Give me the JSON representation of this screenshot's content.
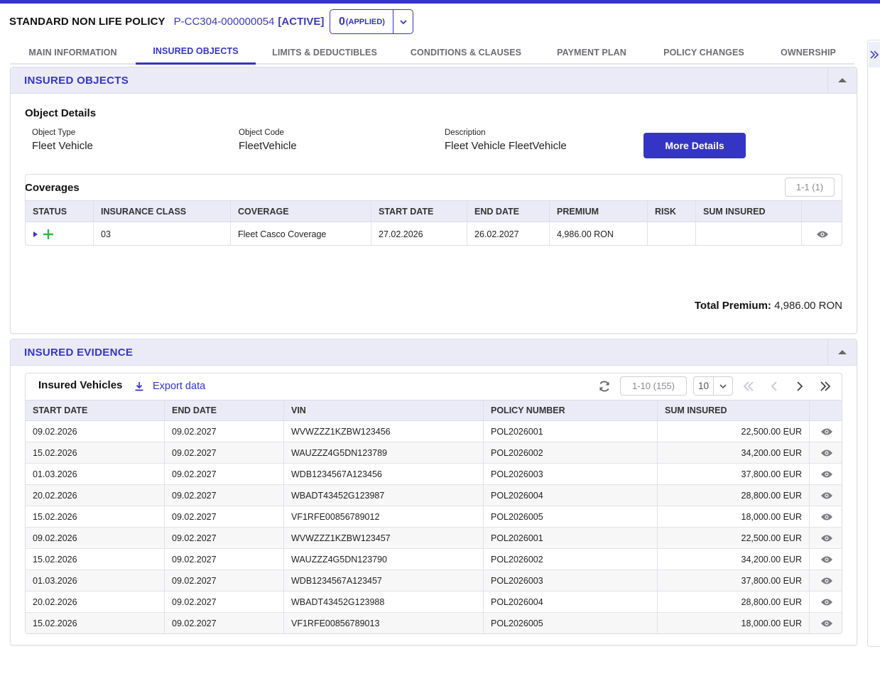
{
  "header": {
    "title": "STANDARD NON LIFE POLICY",
    "policy_id": "P-CC304-000000054",
    "status": "[ACTIVE]",
    "version_number": "0",
    "version_status": "(APPLIED)"
  },
  "tabs": [
    {
      "label": "MAIN INFORMATION"
    },
    {
      "label": "INSURED OBJECTS"
    },
    {
      "label": "LIMITS & DEDUCTIBLES"
    },
    {
      "label": "CONDITIONS & CLAUSES"
    },
    {
      "label": "PAYMENT PLAN"
    },
    {
      "label": "POLICY CHANGES"
    },
    {
      "label": "OWNERSHIP"
    }
  ],
  "active_tab": "INSURED OBJECTS",
  "colors": {
    "accent": "#3535c5",
    "header_bg": "#ebebf7",
    "add_green": "#2db84a"
  },
  "insured_objects": {
    "title": "INSURED OBJECTS",
    "object_details_title": "Object Details",
    "object_type_label": "Object Type",
    "object_type_value": "Fleet Vehicle",
    "object_code_label": "Object Code",
    "object_code_value": "FleetVehicle",
    "description_label": "Description",
    "description_value": "Fleet Vehicle FleetVehicle",
    "more_details_button": "More Details",
    "coverages_title": "Coverages",
    "coverages_pager": "1-1 (1)",
    "coverage_columns": [
      "STATUS",
      "INSURANCE CLASS",
      "COVERAGE",
      "START DATE",
      "END DATE",
      "PREMIUM",
      "RISK",
      "SUM INSURED"
    ],
    "coverage_rows": [
      {
        "insurance_class": "03",
        "coverage": "Fleet Casco Coverage",
        "start_date": "27.02.2026",
        "end_date": "26.02.2027",
        "premium": "4,986.00 RON",
        "risk": "",
        "sum_insured": ""
      }
    ],
    "total_premium_label": "Total Premium:",
    "total_premium_value": "4,986.00 RON"
  },
  "insured_evidence": {
    "title": "INSURED EVIDENCE",
    "table_title": "Insured Vehicles",
    "export_label": "Export data",
    "pager": "1-10 (155)",
    "page_size": "10",
    "columns": [
      "START DATE",
      "END DATE",
      "VIN",
      "POLICY NUMBER",
      "SUM INSURED"
    ],
    "rows": [
      {
        "start_date": "09.02.2026",
        "end_date": "09.02.2027",
        "vin": "WVWZZZ1KZBW123456",
        "policy_number": "POL2026001",
        "sum_insured": "22,500.00 EUR"
      },
      {
        "start_date": "15.02.2026",
        "end_date": "09.02.2027",
        "vin": "WAUZZZ4G5DN123789",
        "policy_number": "POL2026002",
        "sum_insured": "34,200.00 EUR"
      },
      {
        "start_date": "01.03.2026",
        "end_date": "09.02.2027",
        "vin": "WDB1234567A123456",
        "policy_number": "POL2026003",
        "sum_insured": "37,800.00 EUR"
      },
      {
        "start_date": "20.02.2026",
        "end_date": "09.02.2027",
        "vin": "WBADT43452G123987",
        "policy_number": "POL2026004",
        "sum_insured": "28,800.00 EUR"
      },
      {
        "start_date": "15.02.2026",
        "end_date": "09.02.2027",
        "vin": "VF1RFE00856789012",
        "policy_number": "POL2026005",
        "sum_insured": "18,000.00 EUR"
      },
      {
        "start_date": "09.02.2026",
        "end_date": "09.02.2027",
        "vin": "WVWZZZ1KZBW123457",
        "policy_number": "POL2026001",
        "sum_insured": "22,500.00 EUR"
      },
      {
        "start_date": "15.02.2026",
        "end_date": "09.02.2027",
        "vin": "WAUZZZ4G5DN123790",
        "policy_number": "POL2026002",
        "sum_insured": "34,200.00 EUR"
      },
      {
        "start_date": "01.03.2026",
        "end_date": "09.02.2027",
        "vin": "WDB1234567A123457",
        "policy_number": "POL2026003",
        "sum_insured": "37,800.00 EUR"
      },
      {
        "start_date": "20.02.2026",
        "end_date": "09.02.2027",
        "vin": "WBADT43452G123988",
        "policy_number": "POL2026004",
        "sum_insured": "28,800.00 EUR"
      },
      {
        "start_date": "15.02.2026",
        "end_date": "09.02.2027",
        "vin": "VF1RFE00856789013",
        "policy_number": "POL2026005",
        "sum_insured": "18,000.00 EUR"
      }
    ]
  }
}
